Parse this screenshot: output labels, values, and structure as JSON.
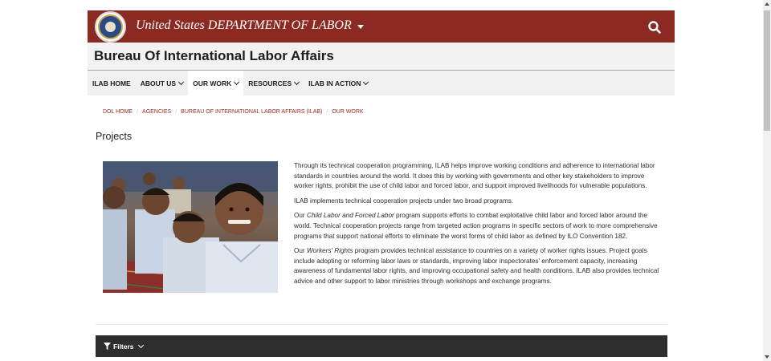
{
  "header": {
    "agency_prefix": "United States ",
    "agency_name": "DEPARTMENT OF LABOR",
    "banner_color": "#8a2a22",
    "seal_icon": "dol-seal-icon",
    "search_icon": "search-icon"
  },
  "bureau": {
    "title": "Bureau Of International Labor Affairs"
  },
  "nav": {
    "items": [
      {
        "label": "ILAB HOME",
        "has_menu": false,
        "active": false
      },
      {
        "label": "ABOUT US",
        "has_menu": true,
        "active": false
      },
      {
        "label": "OUR WORK",
        "has_menu": true,
        "active": true
      },
      {
        "label": "RESOURCES",
        "has_menu": true,
        "active": false
      },
      {
        "label": "ILAB IN ACTION",
        "has_menu": true,
        "active": false
      }
    ]
  },
  "breadcrumb": {
    "items": [
      "DOL HOME",
      "AGENCIES",
      "BUREAU OF INTERNATIONAL LABOR AFFAIRS (ILAB)",
      "OUR WORK"
    ],
    "separator": "/",
    "link_color": "#9a2b20"
  },
  "main": {
    "title": "Projects",
    "p1": "Through its technical cooperation programming, ILAB helps improve working conditions and adherence to international labor standards in countries around the world. It does this by working with governments and other key stakeholders to improve worker rights, prohibit the use of child labor and forced labor, and support improved livelihoods for vulnerable populations.",
    "p2": "ILAB implements technical cooperation projects under two broad programs.",
    "p3_pre": "Our ",
    "p3_em": "Child Labor and Forced Labor",
    "p3_post": " program supports efforts to combat exploitative child labor and forced labor around the world. Technical cooperation projects range from targeted action programs in specific sectors of work to more comprehensive programs that support national efforts to eliminate the worst forms of child labor as defined by ILO Convention 182.",
    "p4_pre": "Our ",
    "p4_em": "Workers' Rights",
    "p4_post": " program provides technical assistance to countries on a variety of worker rights issues. Project goals include adopting or reforming labor laws or standards, improving labor inspectorates' enforcement capacity, increasing awareness of fundamental labor rights, and improving occupational safety and health conditions. ILAB also provides technical advice and other support to labor ministries through workshops and exchange programs."
  },
  "filters": {
    "label": "Filters",
    "icon": "filter-icon",
    "bar_color": "#2e2e2e"
  }
}
